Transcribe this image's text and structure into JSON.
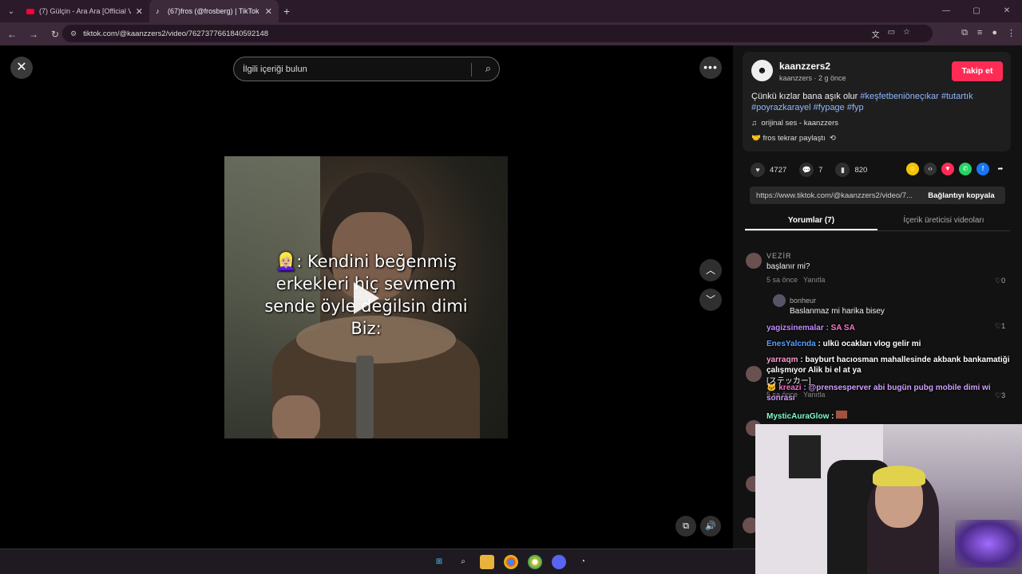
{
  "browser": {
    "tabs": [
      {
        "title": "(7) Gülçin - Ara Ara [Official Vid",
        "active": false
      },
      {
        "title": "(67)fros (@frosberg) | TikTok",
        "active": true
      }
    ],
    "new_tab": "+",
    "url": "tiktok.com/@kaanzzers2/video/7627377661840592148"
  },
  "viewer": {
    "close_label": "✕",
    "search_placeholder": "İlgili içeriği bulun",
    "overlay_text": "👱🏼‍♀️: Kendini beğenmiş erkekleri hiç sevmem sende öyle değilsin dimi Biz:",
    "more_label": "•••",
    "nav_up": "︿",
    "nav_down": "﹀"
  },
  "author": {
    "username": "kaanzzers2",
    "sub": "kaanzzers · 2 g önce",
    "follow_label": "Takip et",
    "desc_text": "Çünkü kızlar bana aşık olur ",
    "desc_tags": "#keşfetbeniöneçıkar #tutartık #poyrazkarayel #fypage #fyp",
    "sound": "orijinal ses - kaanzzers",
    "repost": "fros tekrar paylaştı"
  },
  "actions": {
    "likes": "4727",
    "comments": "7",
    "saves": "820"
  },
  "link": {
    "url": "https://www.tiktok.com/@kaanzzers2/video/7...",
    "copy_label": "Bağlantıyı kopyala"
  },
  "tabs": {
    "comments": "Yorumlar (7)",
    "creator_videos": "İçerik üreticisi videoları"
  },
  "comments": [
    {
      "user": "VEZİR",
      "text": "başlanır mi?",
      "time": "5 sa önce",
      "reply": "Yanıtla",
      "likes": "0"
    },
    {
      "user": "bonheur",
      "text": "Baslanmaz mi harika bisey",
      "likes": "1"
    },
    {
      "time": "5 sa önce",
      "reply": "Yanıtla",
      "likes": "3"
    }
  ],
  "chat": [
    {
      "user": "yagizsinemalar",
      "msg": " : SA  SA",
      "color": "#c48bff"
    },
    {
      "user": "EnesYalcnda",
      "msg": " : ulkü ocakları vlog gelir mi",
      "color": "#5aa0ff"
    },
    {
      "user": "yarraqm",
      "msg": " : bayburt hacıosman mahallesinde akbank bankamatiği çalışmıyor Alik bi el at ya",
      "color": "#ff9bd2"
    },
    {
      "user": "[ステッカー]",
      "msg": "",
      "color": "#ffffff"
    },
    {
      "user": "kreazi",
      "msg": " : @prensesperver abi bugün pubg mobile dimi wi sonrası",
      "color": "#ff66cc"
    },
    {
      "user": "MysticAuraGlow",
      "msg": " : ",
      "color": "#7fffd4"
    }
  ]
}
